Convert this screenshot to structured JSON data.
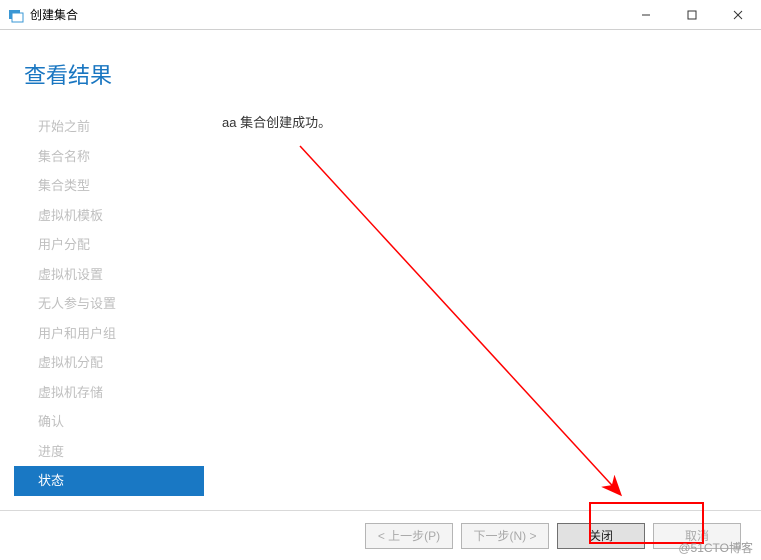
{
  "window": {
    "title": "创建集合"
  },
  "page": {
    "heading": "查看结果"
  },
  "sidebar": {
    "items": [
      {
        "label": "开始之前",
        "active": false
      },
      {
        "label": "集合名称",
        "active": false
      },
      {
        "label": "集合类型",
        "active": false
      },
      {
        "label": "虚拟机模板",
        "active": false
      },
      {
        "label": "用户分配",
        "active": false
      },
      {
        "label": "虚拟机设置",
        "active": false
      },
      {
        "label": "无人参与设置",
        "active": false
      },
      {
        "label": "用户和用户组",
        "active": false
      },
      {
        "label": "虚拟机分配",
        "active": false
      },
      {
        "label": "虚拟机存储",
        "active": false
      },
      {
        "label": "确认",
        "active": false
      },
      {
        "label": "进度",
        "active": false
      },
      {
        "label": "状态",
        "active": true
      }
    ]
  },
  "main": {
    "message": "aa 集合创建成功。"
  },
  "footer": {
    "previous": "< 上一步(P)",
    "next": "下一步(N) >",
    "close": "关闭",
    "cancel": "取消"
  },
  "watermark": "@51CTO博客"
}
